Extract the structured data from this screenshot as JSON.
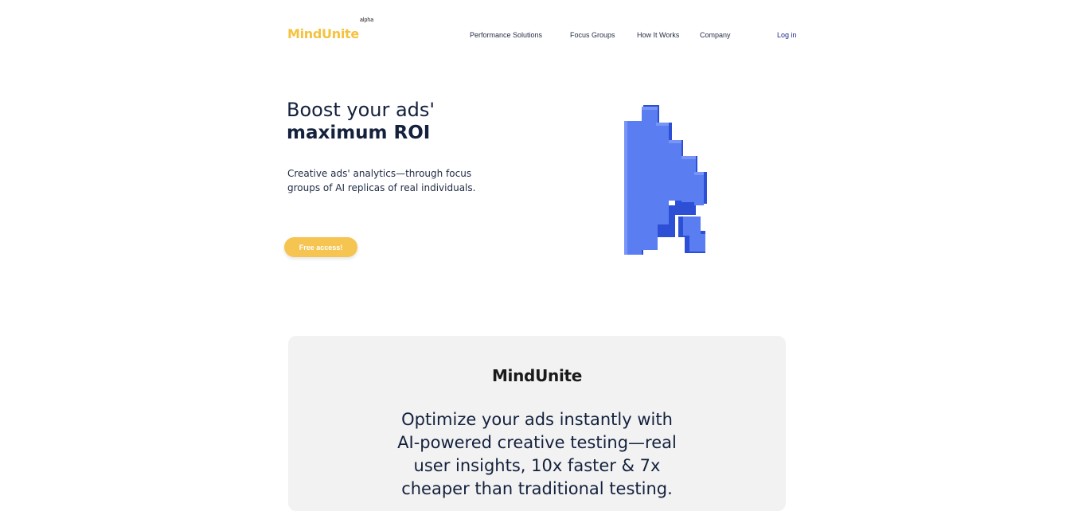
{
  "header": {
    "logo": "MindUnite",
    "badge": "alpha",
    "nav": [
      {
        "label": "Performance Solutions"
      },
      {
        "label": "Focus Groups"
      },
      {
        "label": "How It Works"
      },
      {
        "label": "Company"
      }
    ],
    "login_label": "Log in"
  },
  "hero": {
    "title_line1": "Boost your ads'",
    "title_line2": "maximum ROI",
    "description": "Creative ads' analytics—through focus groups of AI replicas of real individuals.",
    "cta_label": "Free access!"
  },
  "card": {
    "logo": "MindUnite",
    "text": "Optimize your ads instantly with AI-powered creative testing—real user insights, 10x faster & 7x cheaper than traditional testing."
  },
  "colors": {
    "brand_yellow": "#f5c23e",
    "navy": "#14213d",
    "cursor_blue": "#4f73f0"
  }
}
